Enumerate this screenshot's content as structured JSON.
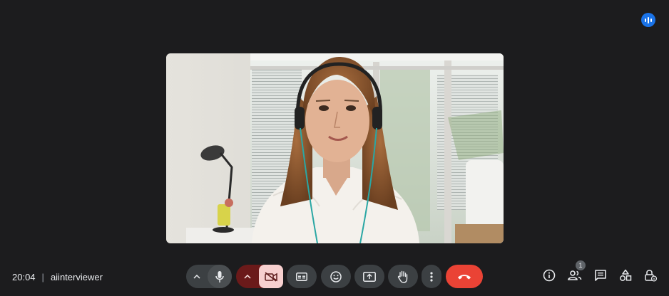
{
  "meeting": {
    "time": "20:04",
    "separator": "|",
    "name": "aiinterviewer"
  },
  "participants": {
    "badge_count": "1"
  },
  "icons": {
    "speaking": "audio-level-icon",
    "audio_options": "chevron-up-icon",
    "mic": "microphone-icon",
    "video_options": "chevron-up-icon",
    "camera": "camera-off-icon",
    "captions": "closed-captions-icon",
    "reactions": "emoji-icon",
    "present": "present-screen-icon",
    "hand": "raise-hand-icon",
    "more": "more-vert-icon",
    "leave": "hang-up-icon",
    "info": "info-icon",
    "people": "people-icon",
    "chat": "chat-icon",
    "activities": "activities-icon",
    "host": "host-controls-icon"
  },
  "colors": {
    "background": "#1c1c1e",
    "control": "#3c4043",
    "camera_off_group": "#6b1a1a",
    "camera_off_button": "#f7d0cf",
    "leave": "#ea4335",
    "speaking": "#1a73e8"
  }
}
